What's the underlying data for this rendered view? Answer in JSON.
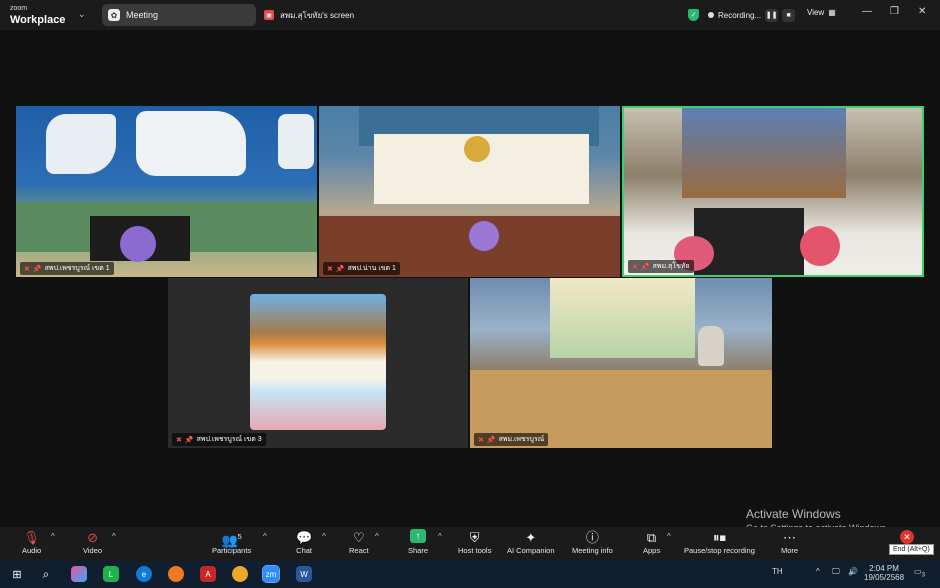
{
  "topbar": {
    "brand_line1": "zoom",
    "brand_line2": "Workplace",
    "meeting_tab": "Meeting",
    "share_tab": "สพม.สุโขทัย's screen",
    "recording_label": "Recording...",
    "view_label": "View"
  },
  "tiles": [
    {
      "name": "สพป.เพชรบูรณ์ เขต 1"
    },
    {
      "name": "สพป.น่าน เขต 1"
    },
    {
      "name": "สพม.สุโขทัย",
      "active": true
    },
    {
      "name": "สพป.เพชรบูรณ์ เขต 3"
    },
    {
      "name": "สพม.เพชรบูรณ์"
    }
  ],
  "toolbar": {
    "audio": "Audio",
    "video": "Video",
    "participants": "Participants",
    "participants_count": "5",
    "chat": "Chat",
    "react": "React",
    "share": "Share",
    "host_tools": "Host tools",
    "ai_companion": "AI Companion",
    "meeting_info": "Meeting info",
    "apps": "Apps",
    "pause_stop": "Pause/stop recording",
    "more": "More",
    "end_tip": "End (Alt+Q)"
  },
  "activate": {
    "title": "Activate Windows",
    "subtitle": "Go to Settings to activate Windows."
  },
  "taskbar": {
    "lang": "TH",
    "time": "2:04 PM",
    "date": "19/05/2568",
    "notif": "3"
  },
  "colors": {
    "active_border": "#3cd070",
    "share_green": "#2bb673",
    "muted_red": "#e24b4b"
  }
}
